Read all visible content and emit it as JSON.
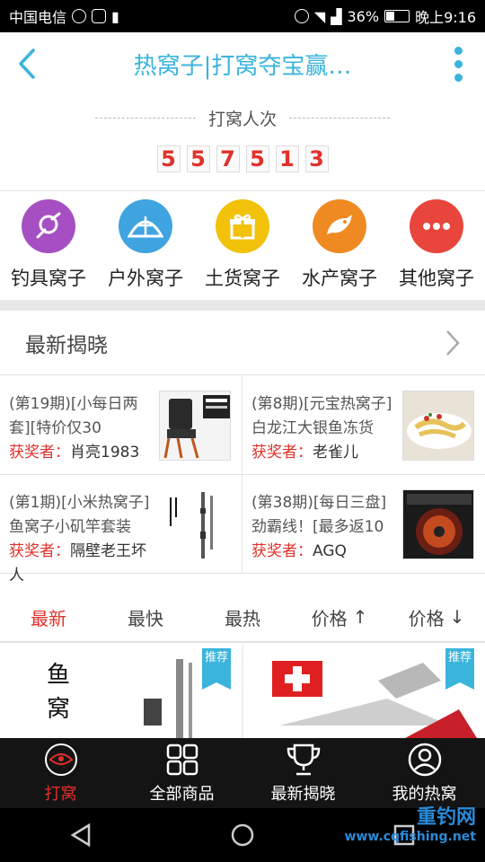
{
  "status_bar": {
    "carrier": "中国电信",
    "battery": "36%",
    "time": "晚上9:16"
  },
  "header": {
    "title": "热窝子|打窝夺宝赢…"
  },
  "counter": {
    "label": "打窝人次",
    "digits": [
      "5",
      "5",
      "7",
      "5",
      "1",
      "3"
    ]
  },
  "categories": [
    {
      "label": "钓具窝子",
      "icon": "fishing-gear-icon",
      "color": "#a64fc2"
    },
    {
      "label": "户外窝子",
      "icon": "tent-icon",
      "color": "#3fa4e0"
    },
    {
      "label": "土货窝子",
      "icon": "gift-icon",
      "color": "#f2c10a"
    },
    {
      "label": "水产窝子",
      "icon": "fish-icon",
      "color": "#ef8a22"
    },
    {
      "label": "其他窝子",
      "icon": "more-dots-icon",
      "color": "#e8453c"
    }
  ],
  "latest": {
    "title": "最新揭晓",
    "winner_label": "获奖者：",
    "items": [
      {
        "name": "(第19期)[小每日两套][特价仅30",
        "winner": "肖亮1983"
      },
      {
        "name": "(第8期)[元宝热窝子]白龙江大银鱼冻货",
        "winner": "老雀儿"
      },
      {
        "name": "(第1期)[小米热窝子]鱼窝子小矶竿套装",
        "winner": "隔壁老王坏人"
      },
      {
        "name": "(第38期)[每日三盘]劲霸线！[最多返10",
        "winner": "AGQ"
      }
    ]
  },
  "sort_tabs": [
    {
      "label": "最新",
      "active": true
    },
    {
      "label": "最快",
      "active": false
    },
    {
      "label": "最热",
      "active": false
    },
    {
      "label": "价格",
      "arrow": "↑",
      "active": false
    },
    {
      "label": "价格",
      "arrow": "↓",
      "active": false
    }
  ],
  "products": {
    "badge": "推荐"
  },
  "bottom_nav": [
    {
      "label": "打窝",
      "icon": "logo-icon",
      "active": true
    },
    {
      "label": "全部商品",
      "icon": "grid-icon",
      "active": false
    },
    {
      "label": "最新揭晓",
      "icon": "trophy-icon",
      "active": false
    },
    {
      "label": "我的热窝",
      "icon": "user-icon",
      "active": false
    }
  ],
  "watermark": {
    "brand": "重钓网",
    "url": "www.cqfishing.net"
  },
  "colors": {
    "accent": "#3bb4dc",
    "red": "#e0312a"
  }
}
